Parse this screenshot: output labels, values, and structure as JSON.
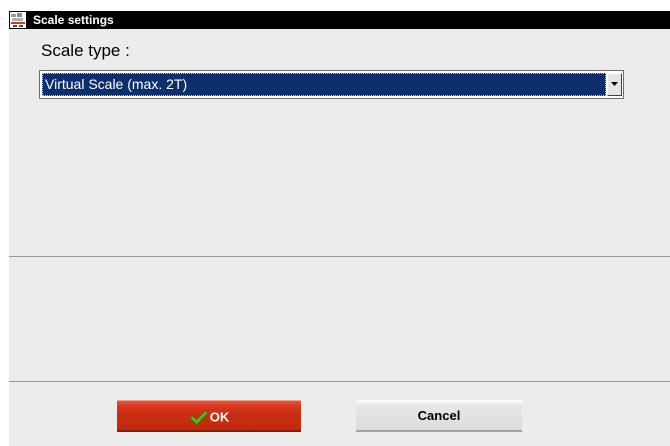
{
  "window": {
    "title": "Scale settings"
  },
  "form": {
    "scale_type_label": "Scale type :",
    "scale_type_selected": "Virtual Scale (max. 2T)"
  },
  "buttons": {
    "ok_label": "OK",
    "cancel_label": "Cancel"
  },
  "icons": {
    "app": "app-icon",
    "ok": "checkmark-icon",
    "dropdown": "dropdown-arrow-icon"
  },
  "colors": {
    "titlebar": "#000000",
    "window_bg": "#ececec",
    "selection_bg": "#0d2f6e",
    "ok_button": "#c72e12",
    "checkmark": "#5db51d"
  }
}
